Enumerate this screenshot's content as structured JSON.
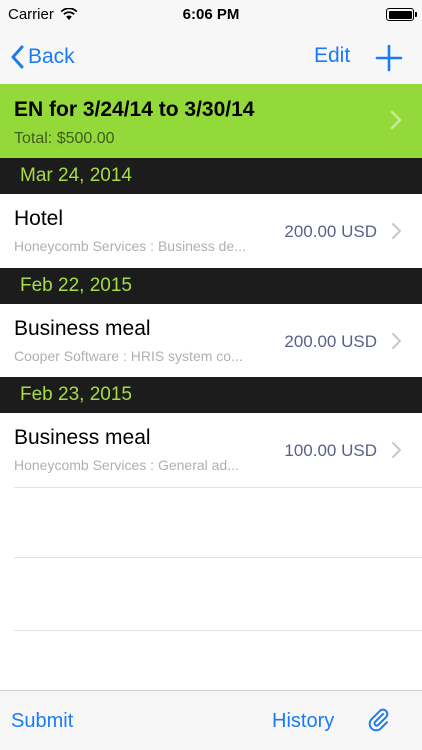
{
  "status_bar": {
    "carrier": "Carrier",
    "time": "6:06 PM"
  },
  "nav": {
    "back_label": "Back",
    "edit_label": "Edit"
  },
  "report": {
    "title": "EN for 3/24/14 to 3/30/14",
    "total": "Total: $500.00"
  },
  "sections": [
    {
      "date": "Mar 24, 2014",
      "items": [
        {
          "title": "Hotel",
          "subtitle": "Honeycomb Services : Business de...",
          "amount": "200.00 USD"
        }
      ]
    },
    {
      "date": "Feb 22, 2015",
      "items": [
        {
          "title": "Business meal",
          "subtitle": "Cooper Software : HRIS system co...",
          "amount": "200.00 USD"
        }
      ]
    },
    {
      "date": "Feb 23, 2015",
      "items": [
        {
          "title": "Business meal",
          "subtitle": "Honeycomb Services : General ad...",
          "amount": "100.00 USD"
        }
      ]
    }
  ],
  "toolbar": {
    "submit_label": "Submit",
    "history_label": "History"
  },
  "colors": {
    "tint": "#1a7cf4",
    "header_green": "#94d93a",
    "section_bg": "#1c1c1c",
    "section_text": "#a6dd45"
  },
  "icons": [
    "wifi-icon",
    "battery-icon",
    "back-chevron-icon",
    "plus-icon",
    "chevron-right-icon",
    "paperclip-icon"
  ]
}
